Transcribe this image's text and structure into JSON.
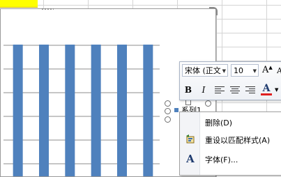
{
  "chart_data": {
    "type": "bar",
    "categories": [
      "",
      "",
      "",
      "",
      "",
      ""
    ],
    "series": [
      {
        "name": "系列1",
        "values": [
          10,
          10,
          10,
          10,
          10,
          10
        ]
      }
    ],
    "grid": true,
    "legend": "right"
  },
  "legend": {
    "series_label": "系列1"
  },
  "mini_toolbar": {
    "font_name": "宋体 (正文",
    "font_size": "10",
    "grow_font_icon": "A",
    "bold": "B",
    "italic": "I",
    "font_color_icon": "A",
    "font_color": "#e02020"
  },
  "context_menu": {
    "items": [
      {
        "label": "删除(D)",
        "icon": ""
      },
      {
        "label": "重设以匹配样式(A)",
        "icon": "reset-style-icon"
      },
      {
        "label": "字体(F)...",
        "icon": "A"
      }
    ]
  },
  "colors": {
    "bar": "#4f81bd",
    "selected_cell": "#ffff00"
  }
}
